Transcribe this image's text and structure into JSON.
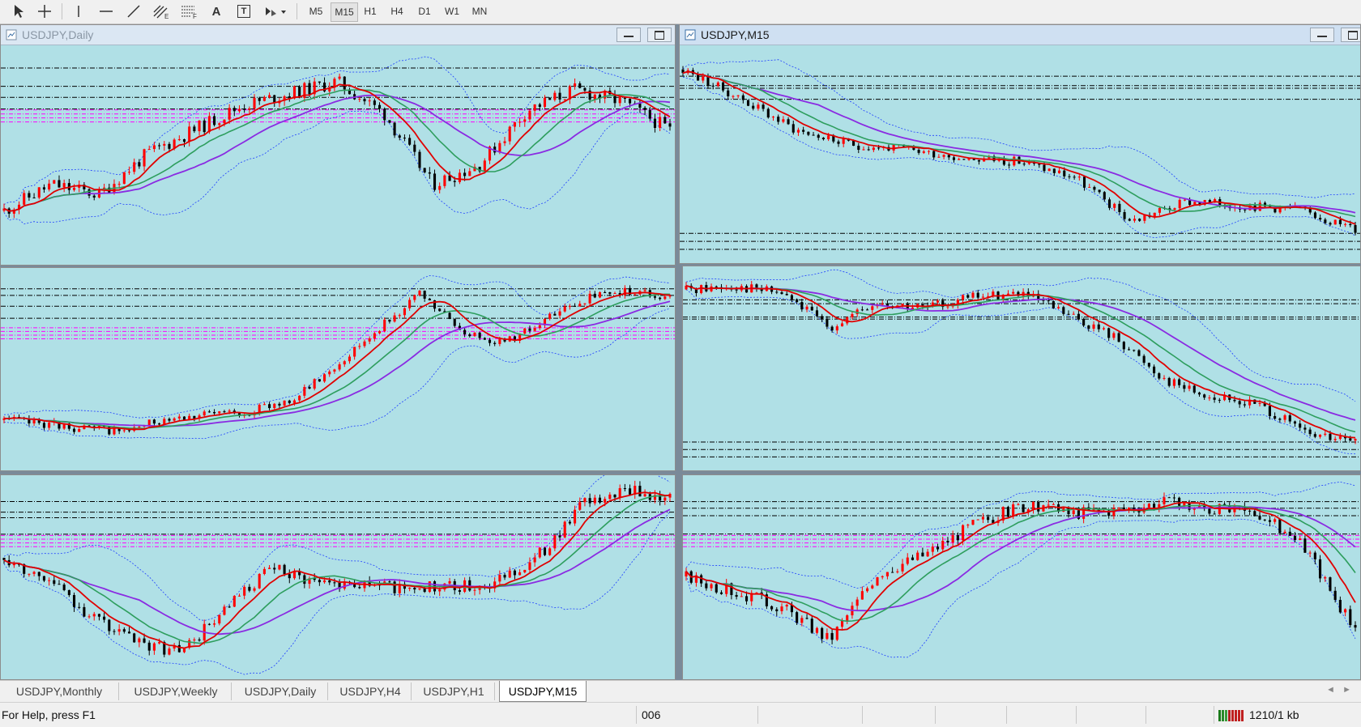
{
  "toolbar": {
    "tools": [
      {
        "icon": "cursor-icon"
      },
      {
        "icon": "crosshair-icon"
      },
      {
        "icon": "vertical-line-icon"
      },
      {
        "icon": "horizontal-line-icon"
      },
      {
        "icon": "trendline-icon"
      },
      {
        "icon": "equidistant-channel-icon",
        "badge": "E"
      },
      {
        "icon": "fibonacci-icon",
        "badge": "F"
      },
      {
        "icon": "text-icon",
        "label": "A"
      },
      {
        "icon": "text-label-icon",
        "label": "T"
      },
      {
        "icon": "arrows-dropdown-icon"
      }
    ],
    "timeframes": [
      "M5",
      "M15",
      "H1",
      "H4",
      "D1",
      "W1",
      "MN"
    ],
    "active_timeframe": "M15"
  },
  "windows": [
    {
      "id": "daily",
      "title": "USDJPY,Daily",
      "active": false
    },
    {
      "id": "m15",
      "title": "USDJPY,M15",
      "active": true
    }
  ],
  "tabs": [
    {
      "label": "USDJPY,Monthly",
      "active": false
    },
    {
      "label": "USDJPY,Weekly",
      "active": false
    },
    {
      "label": "USDJPY,Daily",
      "active": false
    },
    {
      "label": "USDJPY,H4",
      "active": false
    },
    {
      "label": "USDJPY,H1",
      "active": false
    },
    {
      "label": "USDJPY,M15",
      "active": true
    }
  ],
  "status": {
    "help_text": "For Help, press F1",
    "profile": "006",
    "connection": "1210/1 kb"
  },
  "colors": {
    "chart_bg": "#b0e0e6",
    "bull_candle": "#ff0000",
    "bear_candle": "#000000",
    "ma_fast": "#e00000",
    "ma_mid": "#2e9e5e",
    "ma_slow": "#8a2be2",
    "bands": "#1f3fff",
    "levels_black": "#000000",
    "levels_magenta": "#ff00ff"
  },
  "chart_data": [
    {
      "panel": "USDJPY,Daily",
      "type": "candlestick",
      "trend": [
        0.22,
        0.35,
        0.3,
        0.5,
        0.62,
        0.74,
        0.8,
        0.86,
        0.7,
        0.35,
        0.45,
        0.72,
        0.82,
        0.76,
        0.62
      ],
      "vol": 0.045,
      "seed": 11
    },
    {
      "panel": "USDJPY,M15",
      "type": "candlestick",
      "trend": [
        0.92,
        0.78,
        0.62,
        0.54,
        0.52,
        0.48,
        0.46,
        0.38,
        0.16,
        0.26,
        0.24,
        0.22,
        0.12
      ],
      "vol": 0.03,
      "seed": 23
    },
    {
      "panel": "left-middle",
      "type": "candlestick",
      "trend": [
        0.22,
        0.2,
        0.17,
        0.16,
        0.24,
        0.25,
        0.27,
        0.34,
        0.52,
        0.72,
        0.9,
        0.7,
        0.64,
        0.76,
        0.88,
        0.92,
        0.88
      ],
      "vol": 0.03,
      "seed": 37
    },
    {
      "panel": "right-middle",
      "type": "candlestick",
      "trend": [
        0.92,
        0.94,
        0.9,
        0.72,
        0.84,
        0.82,
        0.88,
        0.9,
        0.78,
        0.66,
        0.44,
        0.34,
        0.3,
        0.14,
        0.1
      ],
      "vol": 0.035,
      "seed": 41
    },
    {
      "panel": "left-bottom",
      "type": "candlestick",
      "trend": [
        0.6,
        0.48,
        0.28,
        0.14,
        0.1,
        0.32,
        0.54,
        0.48,
        0.46,
        0.44,
        0.44,
        0.46,
        0.6,
        0.88,
        0.96,
        0.92
      ],
      "vol": 0.045,
      "seed": 53
    },
    {
      "panel": "right-bottom",
      "type": "candlestick",
      "trend": [
        0.5,
        0.42,
        0.34,
        0.16,
        0.52,
        0.62,
        0.78,
        0.88,
        0.84,
        0.86,
        0.9,
        0.86,
        0.84,
        0.64,
        0.2
      ],
      "vol": 0.045,
      "seed": 67
    }
  ]
}
